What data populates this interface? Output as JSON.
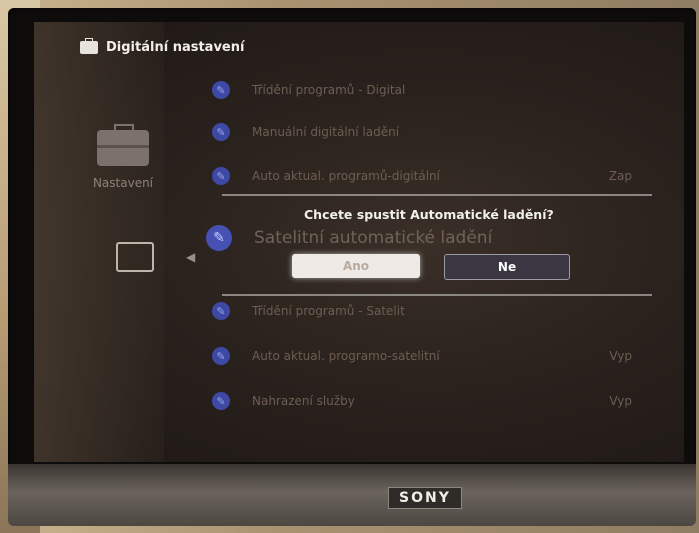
{
  "header": {
    "title": "Digitální nastavení",
    "icon": "briefcase-icon"
  },
  "side": {
    "label": "Nastavení",
    "icon": "toolbox-icon",
    "input_icon": "satellite-dish-icon",
    "arrow": "◀"
  },
  "menu": [
    {
      "label": "Třídění programů - Digital",
      "value": ""
    },
    {
      "label": "Manuální digitální ladění",
      "value": ""
    },
    {
      "label": "Auto aktual. programů-digitální",
      "value": "Zap"
    },
    {
      "label": "Třídění programů - Satelit",
      "value": ""
    },
    {
      "label": "Auto aktual. programo-satelitní",
      "value": "Vyp"
    },
    {
      "label": "Nahrazení služby",
      "value": "Vyp"
    }
  ],
  "highlight_row": {
    "label": "Satelitní automatické ladění"
  },
  "dialog": {
    "question": "Chcete spustit Automatické ladění?",
    "yes": "Ano",
    "no": "Ne"
  },
  "brand": "SONY",
  "colors": {
    "wrench_icon": "#3e49a6",
    "dialog_selected": "#efeae6",
    "dialog_unselected": "#3a3743"
  }
}
